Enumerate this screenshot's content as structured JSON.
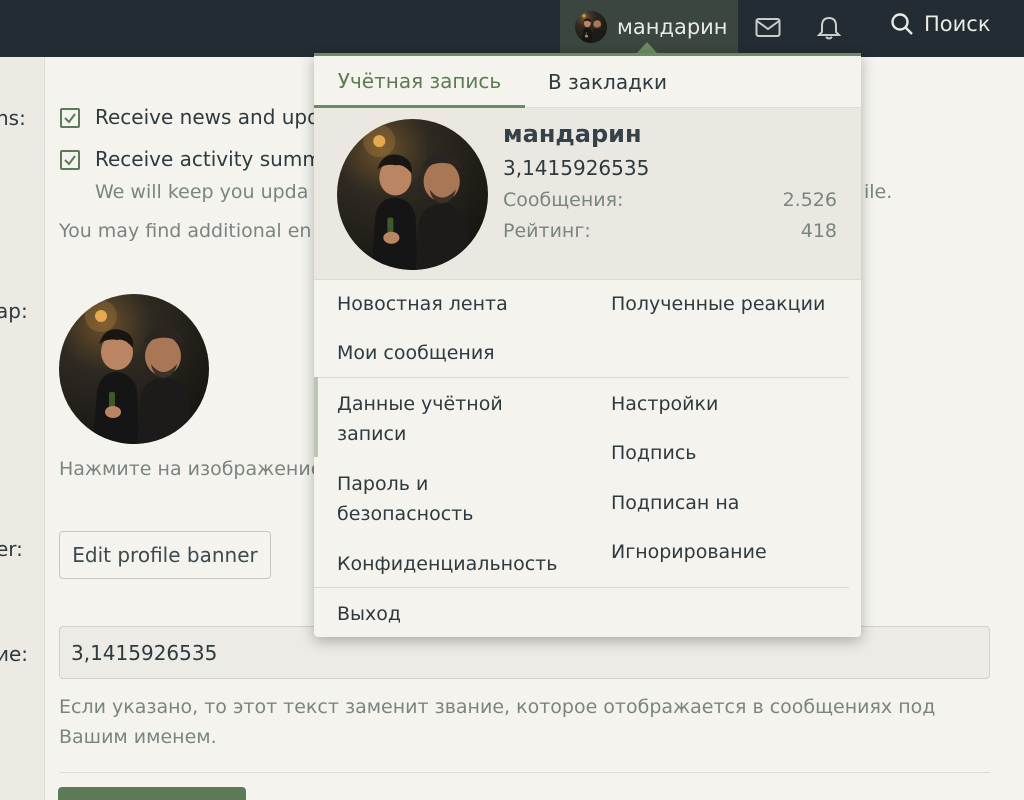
{
  "nav": {
    "username": "мандарин",
    "search_label": "Поиск",
    "icons": [
      "avatar",
      "envelope-icon",
      "bell-icon",
      "search-icon"
    ]
  },
  "background": {
    "label_options": "ns:",
    "checkbox_1": "Receive news and upd",
    "checkbox_2": "Receive activity summ",
    "checkbox_2_hint": "We will keep you upda",
    "checkbox_2_hint_tail": "ile.",
    "additional": "You may find additional en",
    "label_avatar": "ap:",
    "avatar_hint": "Нажмите на изображение",
    "label_banner": "er:",
    "banner_button": "Edit profile banner",
    "label_title": "ие:",
    "title_value": "3,1415926535",
    "title_hint": "Если указано, то этот текст заменит звание, которое отображается в сообщениях под Вашим именем."
  },
  "menu": {
    "tabs": [
      {
        "label": "Учётная запись",
        "active": true
      },
      {
        "label": "В закладки",
        "active": false
      }
    ],
    "profile": {
      "name": "мандарин",
      "user_title": "3,1415926535",
      "stats": [
        {
          "label": "Сообщения:",
          "value": "2.526"
        },
        {
          "label": "Рейтинг:",
          "value": "418"
        }
      ]
    },
    "section1": {
      "left": [
        "Новостная лента",
        "Мои сообщения"
      ],
      "right": [
        "Полученные реакции"
      ]
    },
    "section2": {
      "left": [
        "Данные учётной записи",
        "Пароль и безопасность",
        "Конфиденциальность"
      ],
      "right": [
        "Настройки",
        "Подпись",
        "Подписан на",
        "Игнорирование"
      ]
    },
    "logout": "Выход"
  },
  "colors": {
    "topbar": "#232c32",
    "accent": "#6c8a63",
    "accent_text": "#5e7b56",
    "panel": "#f4f3ee"
  }
}
